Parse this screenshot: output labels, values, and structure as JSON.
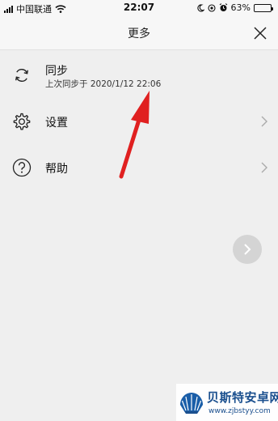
{
  "status_bar": {
    "carrier": "中国联通",
    "time": "22:07",
    "battery_percent": "63%",
    "battery_level": 0.63
  },
  "nav": {
    "title": "更多",
    "close_icon": "close-icon"
  },
  "menu": {
    "items": [
      {
        "label": "同步",
        "sublabel": "上次同步于 2020/1/12 22:06",
        "icon": "sync-icon"
      },
      {
        "label": "设置",
        "icon": "gear-icon"
      },
      {
        "label": "帮助",
        "icon": "help-icon"
      }
    ]
  },
  "watermark": {
    "title": "贝斯特安卓网",
    "url": "www.zjbstyy.com"
  },
  "colors": {
    "annotation_arrow": "#e02020",
    "watermark_blue": "#1a4f8e"
  }
}
